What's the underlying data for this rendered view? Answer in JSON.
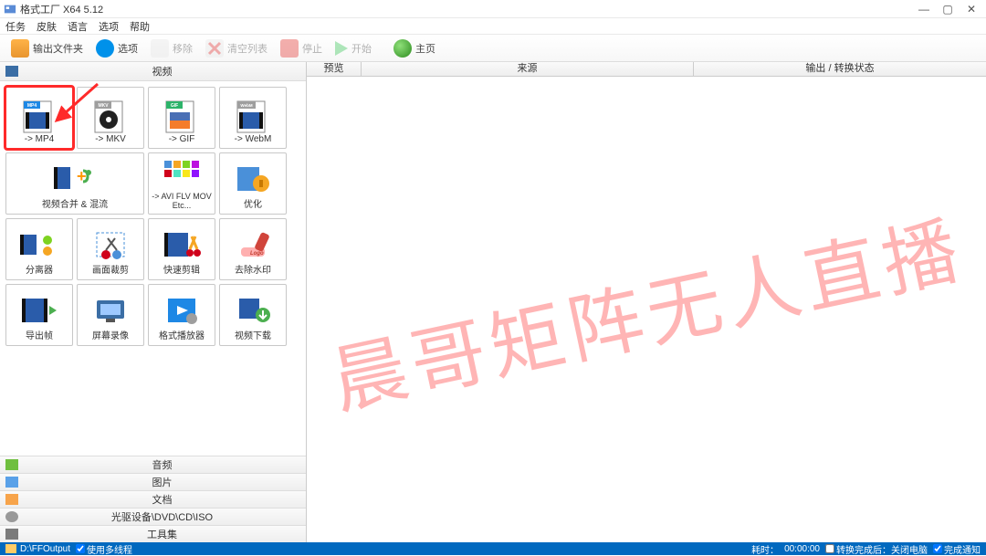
{
  "title": "格式工厂 X64 5.12",
  "window_controls": {
    "min": "—",
    "max": "▢",
    "close": "✕"
  },
  "menu": [
    "任务",
    "皮肤",
    "语言",
    "选项",
    "帮助"
  ],
  "toolbar": [
    {
      "key": "output_folder",
      "label": "输出文件夹",
      "color": "#e8952e",
      "enabled": true
    },
    {
      "key": "options",
      "label": "选项",
      "color": "#0091ea",
      "enabled": true
    },
    {
      "key": "remove",
      "label": "移除",
      "color": "#bbbbbb",
      "enabled": false
    },
    {
      "key": "clear",
      "label": "清空列表",
      "color": "#bbbbbb",
      "enabled": false
    },
    {
      "key": "stop",
      "label": "停止",
      "color": "#e53935",
      "enabled": false
    },
    {
      "key": "start",
      "label": "开始",
      "color": "#39c658",
      "enabled": false
    },
    {
      "key": "home",
      "label": "主页",
      "color": "#2c8b1e",
      "enabled": true
    }
  ],
  "left": {
    "current_category": "视频",
    "items": [
      {
        "label": "-> MP4",
        "badge": "MP4",
        "badge_color": "#1e88e5"
      },
      {
        "label": "-> MKV",
        "badge": "MKV",
        "badge_color": "#9e9e9e"
      },
      {
        "label": "-> GIF",
        "badge": "GIF",
        "badge_color": "#2db36a"
      },
      {
        "label": "-> WebM",
        "badge": "WebM",
        "badge_color": "#9e9e9e"
      },
      {
        "label": "视频合并 & 混流",
        "badge": "",
        "badge_color": ""
      },
      {
        "label": "",
        "badge": "",
        "badge_color": ""
      },
      {
        "label": "-> AVI FLV MOV Etc...",
        "badge": "",
        "badge_color": ""
      },
      {
        "label": "优化",
        "badge": "",
        "badge_color": ""
      },
      {
        "label": "分离器",
        "badge": "",
        "badge_color": ""
      },
      {
        "label": "画面裁剪",
        "badge": "",
        "badge_color": ""
      },
      {
        "label": "快速剪辑",
        "badge": "",
        "badge_color": ""
      },
      {
        "label": "去除水印",
        "badge": "",
        "badge_color": ""
      },
      {
        "label": "导出帧",
        "badge": "",
        "badge_color": ""
      },
      {
        "label": "屏幕录像",
        "badge": "",
        "badge_color": ""
      },
      {
        "label": "格式播放器",
        "badge": "",
        "badge_color": ""
      },
      {
        "label": "视频下载",
        "badge": "",
        "badge_color": ""
      }
    ],
    "categories": [
      {
        "label": "音频",
        "icon_color": "#6fbf3f"
      },
      {
        "label": "图片",
        "icon_color": "#5aa1e8"
      },
      {
        "label": "文档",
        "icon_color": "#f7a44b"
      },
      {
        "label": "光驱设备\\DVD\\CD\\ISO",
        "icon_color": "#999999"
      },
      {
        "label": "工具集",
        "icon_color": "#7b7b7b"
      }
    ]
  },
  "right": {
    "headers": {
      "preview": "预览",
      "source": "来源",
      "status": "输出 / 转换状态"
    }
  },
  "watermark": "晨哥矩阵无人直播",
  "status": {
    "output_path": "D:\\FFOutput",
    "multithread_label": "使用多线程",
    "multithread_checked": true,
    "elapsed_label": "耗时：",
    "elapsed_value": "00:00:00",
    "shutdown_label": "转换完成后：关闭电脑",
    "shutdown_checked": false,
    "notify_label": "完成通知",
    "notify_checked": true
  }
}
